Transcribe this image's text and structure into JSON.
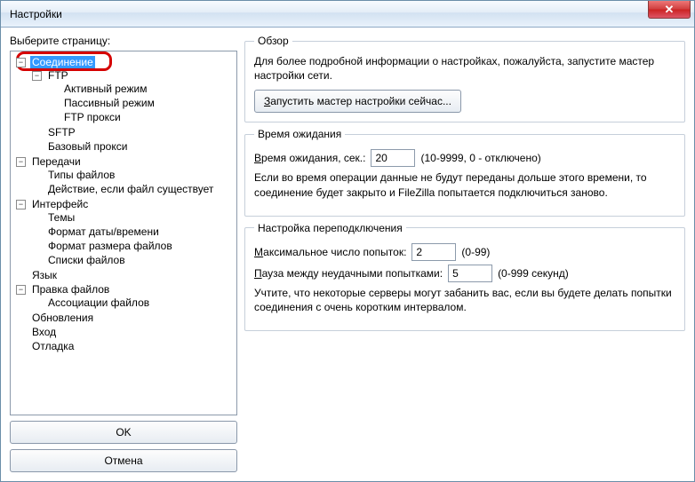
{
  "window": {
    "title": "Настройки",
    "close_glyph": "✕"
  },
  "left": {
    "label": "Выберите страницу:",
    "ok_label": "OK",
    "cancel_label": "Отмена"
  },
  "tree": {
    "connection": "Соединение",
    "ftp": "FTP",
    "ftp_active": "Активный режим",
    "ftp_passive": "Пассивный режим",
    "ftp_proxy": "FTP прокси",
    "sftp": "SFTP",
    "generic_proxy": "Базовый прокси",
    "transfers": "Передачи",
    "file_types": "Типы файлов",
    "file_exists": "Действие, если файл существует",
    "interface": "Интерфейс",
    "themes": "Темы",
    "date_format": "Формат даты/времени",
    "size_format": "Формат размера файлов",
    "file_lists": "Списки файлов",
    "language": "Язык",
    "file_editing": "Правка файлов",
    "file_assoc": "Ассоциации файлов",
    "updates": "Обновления",
    "logging": "Вход",
    "debug": "Отладка",
    "toggle_minus": "−",
    "toggle_plus": "+"
  },
  "overview": {
    "legend": "Обзор",
    "desc": "Для более подробной информации о настройках, пожалуйста, запустите мастер настройки сети.",
    "run_wizard_prefix": "З",
    "run_wizard_rest": "апустить мастер настройки сейчас..."
  },
  "timeout": {
    "legend": "Время ожидания",
    "label_prefix": "В",
    "label_rest": "ремя ожидания, сек.:",
    "value": "20",
    "hint": "(10-9999, 0 - отключено)",
    "desc": "Если во время операции данные не будут переданы дольше этого времени, то соединение будет закрыто и FileZilla попытается подключиться заново."
  },
  "reconnect": {
    "legend": "Настройка переподключения",
    "retries_label_prefix": "М",
    "retries_label_rest": "аксимальное число попыток:",
    "retries_value": "2",
    "retries_hint": "(0-99)",
    "delay_label_prefix": "П",
    "delay_label_rest": "ауза между неудачными попытками:",
    "delay_value": "5",
    "delay_hint": "(0-999 секунд)",
    "desc": "Учтите, что некоторые серверы могут забанить вас, если вы будете делать попытки соединения с очень коротким интервалом."
  }
}
